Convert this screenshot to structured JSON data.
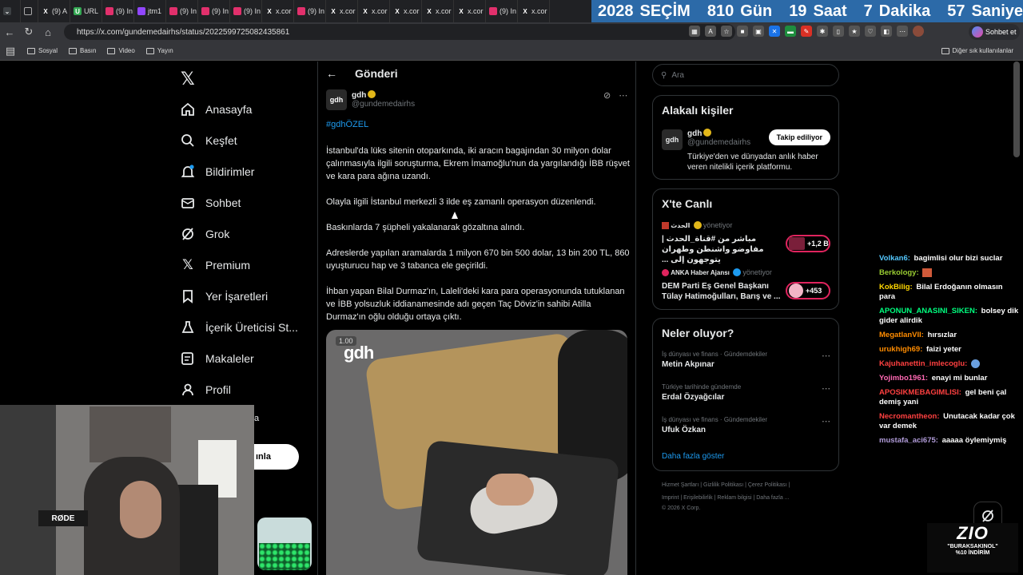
{
  "browser": {
    "tabs": [
      {
        "label": "",
        "icon": "tab-group-icon",
        "color": "#5f6368"
      },
      {
        "label": "(9) A",
        "icon": "x-icon",
        "color": "#000000"
      },
      {
        "label": "URL",
        "icon": "url-icon",
        "color": "#34a853"
      },
      {
        "label": "(9) In",
        "icon": "instagram-icon",
        "color": "#e1306c"
      },
      {
        "label": "jtm1",
        "icon": "twitch-icon",
        "color": "#9146ff"
      },
      {
        "label": "(9) In",
        "icon": "instagram-icon",
        "color": "#e1306c"
      },
      {
        "label": "(9) In",
        "icon": "instagram-icon",
        "color": "#e1306c"
      },
      {
        "label": "(9) In",
        "icon": "instagram-icon",
        "color": "#e1306c"
      },
      {
        "label": "x.cor",
        "icon": "x-icon",
        "color": "#000000"
      },
      {
        "label": "(9) In",
        "icon": "instagram-icon",
        "color": "#e1306c"
      },
      {
        "label": "x.cor",
        "icon": "x-icon",
        "color": "#000000"
      },
      {
        "label": "x.cor",
        "icon": "x-icon",
        "color": "#000000"
      },
      {
        "label": "x.cor",
        "icon": "x-icon",
        "color": "#000000"
      },
      {
        "label": "x.cor",
        "icon": "x-icon",
        "color": "#000000"
      },
      {
        "label": "x.cor",
        "icon": "x-icon",
        "color": "#000000"
      },
      {
        "label": "(9) In",
        "icon": "instagram-icon",
        "color": "#e1306c"
      },
      {
        "label": "x.cor",
        "icon": "x-icon",
        "color": "#000000"
      }
    ],
    "url": "https://x.com/gundemedairhs/status/2022599725082435861",
    "profile_button": "Sohbet et",
    "bookmarks": [
      "Sosyal",
      "Basın",
      "Video",
      "Yayın"
    ],
    "bookmarks_other": "Diğer sık kullanılanlar"
  },
  "countdown": {
    "year": "2028",
    "year_label": "SEÇİM",
    "days": "810",
    "days_label": "Gün",
    "hours": "19",
    "hours_label": "Saat",
    "minutes": "7",
    "minutes_label": "Dakika",
    "seconds": "57",
    "seconds_label": "Saniye"
  },
  "sidebar": {
    "items": [
      {
        "label": "Anasayfa",
        "icon": "home-icon"
      },
      {
        "label": "Keşfet",
        "icon": "search-icon"
      },
      {
        "label": "Bildirimler",
        "icon": "bell-icon"
      },
      {
        "label": "Sohbet",
        "icon": "mail-icon"
      },
      {
        "label": "Grok",
        "icon": "grok-icon"
      },
      {
        "label": "Premium",
        "icon": "x-icon"
      },
      {
        "label": "Yer İşaretleri",
        "icon": "bookmark-icon"
      },
      {
        "label": "İçerik Üreticisi St...",
        "icon": "flask-icon"
      },
      {
        "label": "Makaleler",
        "icon": "article-icon"
      },
      {
        "label": "Profil",
        "icon": "person-icon"
      }
    ],
    "partial_label": "a",
    "post_button_partial": "ınla"
  },
  "post": {
    "header_title": "Gönderi",
    "author_name": "gdh",
    "author_handle": "@gundemedairhs",
    "avatar_text": "gdh",
    "hashtag": "#gdhÖZEL",
    "paragraphs": [
      "İstanbul'da lüks sitenin otoparkında, iki aracın bagajından 30 milyon dolar çalınmasıyla ilgili soruşturma, Ekrem İmamoğlu'nun da yargılandığı İBB rüşvet ve kara para ağına uzandı.",
      "Olayla ilgili İstanbul merkezli 3 ilde eş zamanlı operasyon düzenlendi.",
      "Baskınlarda 7 şüpheli yakalanarak gözaltına alındı.",
      "Adreslerde yapılan aramalarda 1 milyon 670 bin 500 dolar, 13 bin 200 TL, 860 uyuşturucu hap ve 3 tabanca ele geçirildi.",
      "İhban yapan Bilal Durmaz'ın, Laleli'deki kara para operasyonunda tutuklanan ve İBB yolsuzluk iddianamesinde adı geçen Taç Döviz'in sahibi Atilla Durmaz'ın oğlu olduğu ortaya çıktı."
    ],
    "media_rate": "1.00",
    "media_watermark": "gdh"
  },
  "right": {
    "search_placeholder": "Ara",
    "related_title": "Alakalı kişiler",
    "related_name": "gdh",
    "related_handle": "@gundemedairhs",
    "related_bio": "Türkiye'den ve dünyadan anlık haber veren nitelikli içerik platformu.",
    "follow_label": "Takip ediliyor",
    "live_title": "X'te Canlı",
    "live": [
      {
        "host": "الحدث",
        "status": "yönetiyor",
        "title": "مباشر من #قناة_الحدث | مفاوضو واشنطن وطهران يتوجهون إلى ...",
        "count": "+1,2 B"
      },
      {
        "host": "ANKA Haber Ajansı",
        "status": "yönetiyor",
        "title": "DEM Parti Eş Genel Başkanı Tülay Hatimoğulları, Barış ve ...",
        "count": "+453"
      }
    ],
    "trends_title": "Neler oluyor?",
    "trends": [
      {
        "context": "İş dünyası ve finans · Gündemdekiler",
        "name": "Metin Akpınar"
      },
      {
        "context": "Türkiye tarihinde gündemde",
        "name": "Erdal Özyağcılar"
      },
      {
        "context": "İş dünyası ve finans · Gündemdekiler",
        "name": "Ufuk Özkan"
      }
    ],
    "show_more": "Daha fazla göster",
    "footer_line1": "Hizmet Şartları  |  Gizlilik Politikası  |  Çerez Politikası  |",
    "footer_line2": "Imprint  |  Erişilebilirlik  |  Reklam bilgisi  |  Daha fazla ...",
    "footer_line3": "© 2026 X Corp."
  },
  "chat": [
    {
      "user": "Volkan6:",
      "color": "#54c8ff",
      "msg": "bagimlisi olur bizi suclar"
    },
    {
      "user": "Berkology:",
      "color": "#9acd32",
      "msg": ""
    },
    {
      "user": "KokBilig:",
      "color": "#ffd700",
      "msg": "Bilal Erdoğanın olmasın para"
    },
    {
      "user": "APONUN_ANASINI_SIKEN:",
      "color": "#00ff7f",
      "msg": "bolsey dik gider alirdik"
    },
    {
      "user": "MegatlanVII:",
      "color": "#ff8c00",
      "msg": "hırsızlar"
    },
    {
      "user": "urukhigh69:",
      "color": "#ff8c00",
      "msg": "faizi yeter"
    },
    {
      "user": "Kajuhanettin_imlecoglu:",
      "color": "#ff4040",
      "msg": ""
    },
    {
      "user": "Yojimbo1961:",
      "color": "#ff69b4",
      "msg": "enayi mi bunlar"
    },
    {
      "user": "APOSIKMEBAGIMLISI:",
      "color": "#ff4040",
      "msg": "gel beni çal demiş yani"
    },
    {
      "user": "Necromantheon:",
      "color": "#ff4040",
      "msg": "Unutacak kadar çok var demek"
    },
    {
      "user": "mustafa_aci675:",
      "color": "#b19cd9",
      "msg": "aaaaa öylemiymiş"
    }
  ],
  "overlay": {
    "mic_label": "RØDE",
    "brand": "ZIO",
    "promo_line1": "\"BURAKSAKINOL\"",
    "promo_line2": "%10 İNDİRİM"
  },
  "colors": {
    "accent": "#1d9bf0",
    "verified": "#e2b719",
    "live_ring": "#e0245e",
    "countdown_bg": "#2c6aa8"
  }
}
